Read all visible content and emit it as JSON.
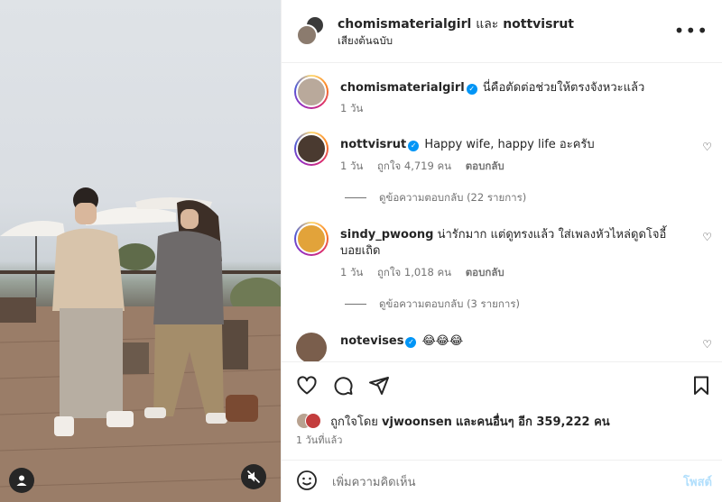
{
  "header": {
    "author_1": "chomismaterialgirl",
    "joiner": "และ",
    "author_2": "nottvisrut",
    "audio": "เสียงต้นฉบับ",
    "more_icon": "more-horizontal-icon"
  },
  "comments": [
    {
      "user": "chomismaterialgirl",
      "text": "นี่คือตัดต่อช่วยให้ตรงจังหวะแล้ว",
      "time": "1 วัน",
      "is_caption": true
    },
    {
      "user": "nottvisrut",
      "text": "Happy wife, happy life อะครับ",
      "time": "1 วัน",
      "likes": "ถูกใจ 4,719 คน",
      "reply": "ตอบกลับ",
      "view_replies": "ดูข้อความตอบกลับ (22 รายการ)"
    },
    {
      "user": "sindy_pwoong",
      "text": "น่ารักมาก แต่ดูทรงแล้ว ใส่เพลงหัวไหล่ดูดโจอี้บอยเถิด",
      "time": "1 วัน",
      "likes": "ถูกใจ 1,018 คน",
      "reply": "ตอบกลับ",
      "view_replies": "ดูข้อความตอบกลับ (3 รายการ)"
    },
    {
      "user": "notevises",
      "text": "😂😂😂"
    }
  ],
  "actions": {
    "liked_by_prefix": "ถูกใจโดย",
    "liked_by_user": "vjwoonsen",
    "liked_by_suffix": "และคนอื่นๆ อีก 359,222 คน",
    "timestamp": "1 วันที่แล้ว"
  },
  "composer": {
    "placeholder": "เพิ่มความคิดเห็น",
    "post_label": "โพสต์"
  },
  "colors": {
    "verified": "#0095f6",
    "post_disabled": "#b2dffc",
    "secondary_text": "#737373"
  }
}
